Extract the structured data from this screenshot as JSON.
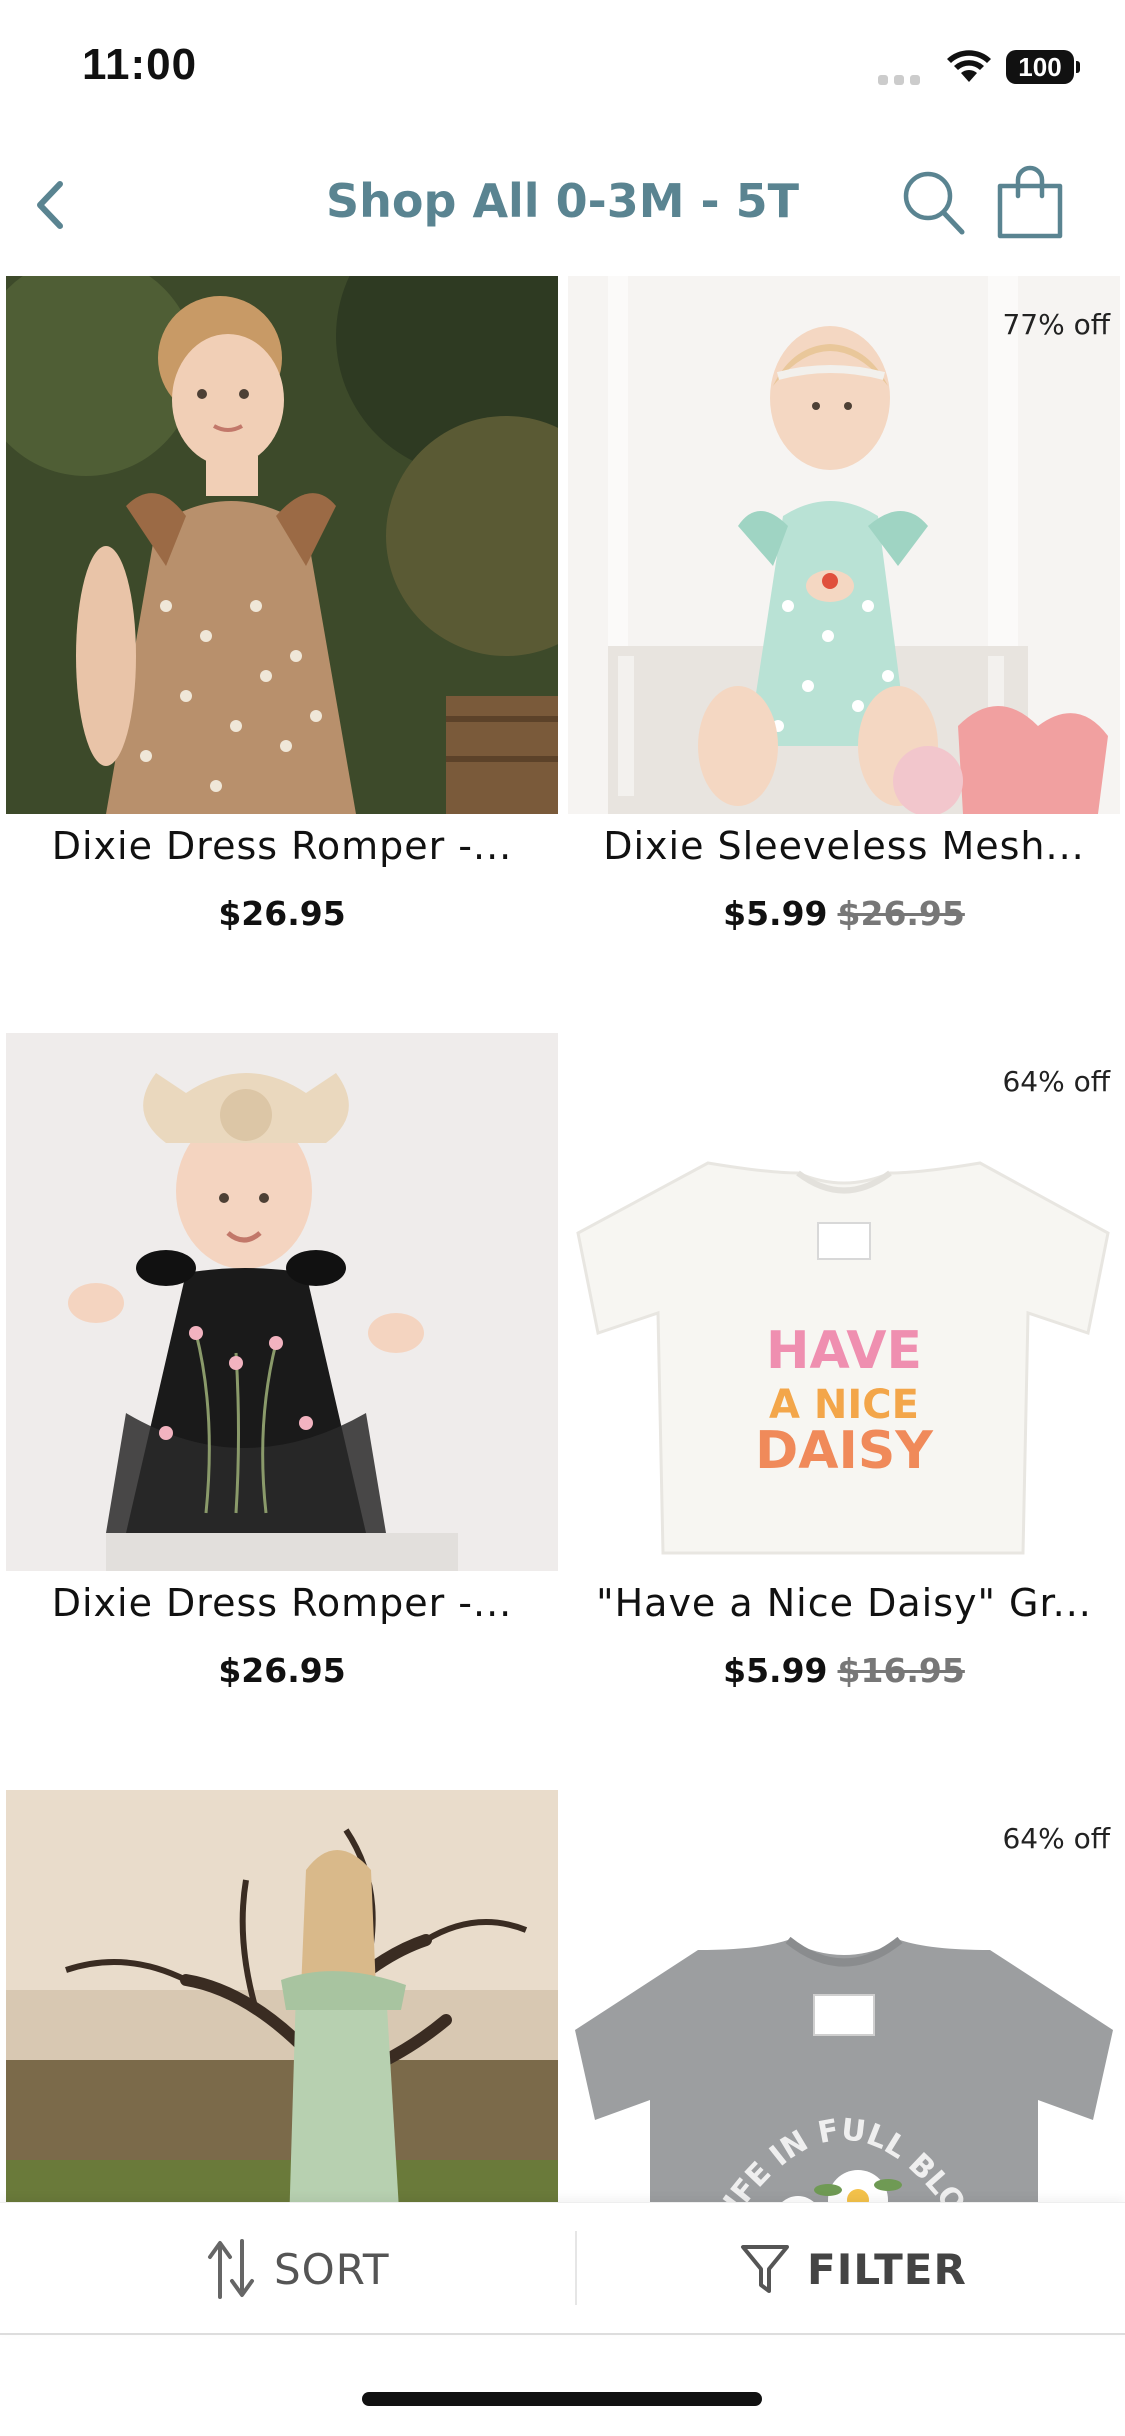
{
  "status_bar": {
    "time": "11:00",
    "battery": "100"
  },
  "nav": {
    "title": "Shop All 0-3M - 5T"
  },
  "products": [
    {
      "title": "Dixie Dress Romper -...",
      "price": "$26.95",
      "original_price": "",
      "badge": ""
    },
    {
      "title": "Dixie Sleeveless Mesh...",
      "price": "$5.99",
      "original_price": "$26.95",
      "badge": "77% off"
    },
    {
      "title": "Dixie Dress Romper -...",
      "price": "$26.95",
      "original_price": "",
      "badge": ""
    },
    {
      "title": "\"Have a Nice Daisy\" Gr...",
      "price": "$5.99",
      "original_price": "$16.95",
      "badge": "64% off"
    },
    {
      "title": "",
      "price": "",
      "original_price": "",
      "badge": ""
    },
    {
      "title": "",
      "price": "",
      "original_price": "",
      "badge": "64% off"
    }
  ],
  "tee_graphic": {
    "line1": "HAVE",
    "line2": "A NICE",
    "line3": "DAISY"
  },
  "tee2_graphic": {
    "arc_text": "LIFE IN FULL BLO"
  },
  "bottom_bar": {
    "sort_label": "SORT",
    "filter_label": "FILTER"
  },
  "colors": {
    "accent": "#5a8491",
    "badge_text": "#222222"
  }
}
